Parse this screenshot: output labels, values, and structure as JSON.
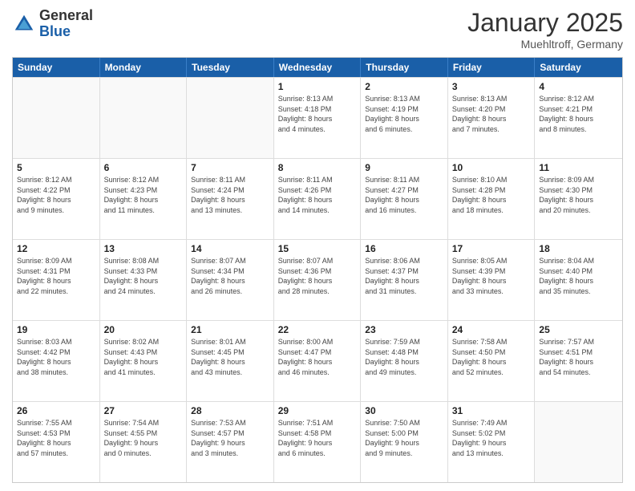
{
  "header": {
    "logo_general": "General",
    "logo_blue": "Blue",
    "month_title": "January 2025",
    "location": "Muehltroff, Germany"
  },
  "calendar": {
    "days_of_week": [
      "Sunday",
      "Monday",
      "Tuesday",
      "Wednesday",
      "Thursday",
      "Friday",
      "Saturday"
    ],
    "weeks": [
      [
        {
          "day": "",
          "info": ""
        },
        {
          "day": "",
          "info": ""
        },
        {
          "day": "",
          "info": ""
        },
        {
          "day": "1",
          "info": "Sunrise: 8:13 AM\nSunset: 4:18 PM\nDaylight: 8 hours\nand 4 minutes."
        },
        {
          "day": "2",
          "info": "Sunrise: 8:13 AM\nSunset: 4:19 PM\nDaylight: 8 hours\nand 6 minutes."
        },
        {
          "day": "3",
          "info": "Sunrise: 8:13 AM\nSunset: 4:20 PM\nDaylight: 8 hours\nand 7 minutes."
        },
        {
          "day": "4",
          "info": "Sunrise: 8:12 AM\nSunset: 4:21 PM\nDaylight: 8 hours\nand 8 minutes."
        }
      ],
      [
        {
          "day": "5",
          "info": "Sunrise: 8:12 AM\nSunset: 4:22 PM\nDaylight: 8 hours\nand 9 minutes."
        },
        {
          "day": "6",
          "info": "Sunrise: 8:12 AM\nSunset: 4:23 PM\nDaylight: 8 hours\nand 11 minutes."
        },
        {
          "day": "7",
          "info": "Sunrise: 8:11 AM\nSunset: 4:24 PM\nDaylight: 8 hours\nand 13 minutes."
        },
        {
          "day": "8",
          "info": "Sunrise: 8:11 AM\nSunset: 4:26 PM\nDaylight: 8 hours\nand 14 minutes."
        },
        {
          "day": "9",
          "info": "Sunrise: 8:11 AM\nSunset: 4:27 PM\nDaylight: 8 hours\nand 16 minutes."
        },
        {
          "day": "10",
          "info": "Sunrise: 8:10 AM\nSunset: 4:28 PM\nDaylight: 8 hours\nand 18 minutes."
        },
        {
          "day": "11",
          "info": "Sunrise: 8:09 AM\nSunset: 4:30 PM\nDaylight: 8 hours\nand 20 minutes."
        }
      ],
      [
        {
          "day": "12",
          "info": "Sunrise: 8:09 AM\nSunset: 4:31 PM\nDaylight: 8 hours\nand 22 minutes."
        },
        {
          "day": "13",
          "info": "Sunrise: 8:08 AM\nSunset: 4:33 PM\nDaylight: 8 hours\nand 24 minutes."
        },
        {
          "day": "14",
          "info": "Sunrise: 8:07 AM\nSunset: 4:34 PM\nDaylight: 8 hours\nand 26 minutes."
        },
        {
          "day": "15",
          "info": "Sunrise: 8:07 AM\nSunset: 4:36 PM\nDaylight: 8 hours\nand 28 minutes."
        },
        {
          "day": "16",
          "info": "Sunrise: 8:06 AM\nSunset: 4:37 PM\nDaylight: 8 hours\nand 31 minutes."
        },
        {
          "day": "17",
          "info": "Sunrise: 8:05 AM\nSunset: 4:39 PM\nDaylight: 8 hours\nand 33 minutes."
        },
        {
          "day": "18",
          "info": "Sunrise: 8:04 AM\nSunset: 4:40 PM\nDaylight: 8 hours\nand 35 minutes."
        }
      ],
      [
        {
          "day": "19",
          "info": "Sunrise: 8:03 AM\nSunset: 4:42 PM\nDaylight: 8 hours\nand 38 minutes."
        },
        {
          "day": "20",
          "info": "Sunrise: 8:02 AM\nSunset: 4:43 PM\nDaylight: 8 hours\nand 41 minutes."
        },
        {
          "day": "21",
          "info": "Sunrise: 8:01 AM\nSunset: 4:45 PM\nDaylight: 8 hours\nand 43 minutes."
        },
        {
          "day": "22",
          "info": "Sunrise: 8:00 AM\nSunset: 4:47 PM\nDaylight: 8 hours\nand 46 minutes."
        },
        {
          "day": "23",
          "info": "Sunrise: 7:59 AM\nSunset: 4:48 PM\nDaylight: 8 hours\nand 49 minutes."
        },
        {
          "day": "24",
          "info": "Sunrise: 7:58 AM\nSunset: 4:50 PM\nDaylight: 8 hours\nand 52 minutes."
        },
        {
          "day": "25",
          "info": "Sunrise: 7:57 AM\nSunset: 4:51 PM\nDaylight: 8 hours\nand 54 minutes."
        }
      ],
      [
        {
          "day": "26",
          "info": "Sunrise: 7:55 AM\nSunset: 4:53 PM\nDaylight: 8 hours\nand 57 minutes."
        },
        {
          "day": "27",
          "info": "Sunrise: 7:54 AM\nSunset: 4:55 PM\nDaylight: 9 hours\nand 0 minutes."
        },
        {
          "day": "28",
          "info": "Sunrise: 7:53 AM\nSunset: 4:57 PM\nDaylight: 9 hours\nand 3 minutes."
        },
        {
          "day": "29",
          "info": "Sunrise: 7:51 AM\nSunset: 4:58 PM\nDaylight: 9 hours\nand 6 minutes."
        },
        {
          "day": "30",
          "info": "Sunrise: 7:50 AM\nSunset: 5:00 PM\nDaylight: 9 hours\nand 9 minutes."
        },
        {
          "day": "31",
          "info": "Sunrise: 7:49 AM\nSunset: 5:02 PM\nDaylight: 9 hours\nand 13 minutes."
        },
        {
          "day": "",
          "info": ""
        }
      ]
    ]
  }
}
